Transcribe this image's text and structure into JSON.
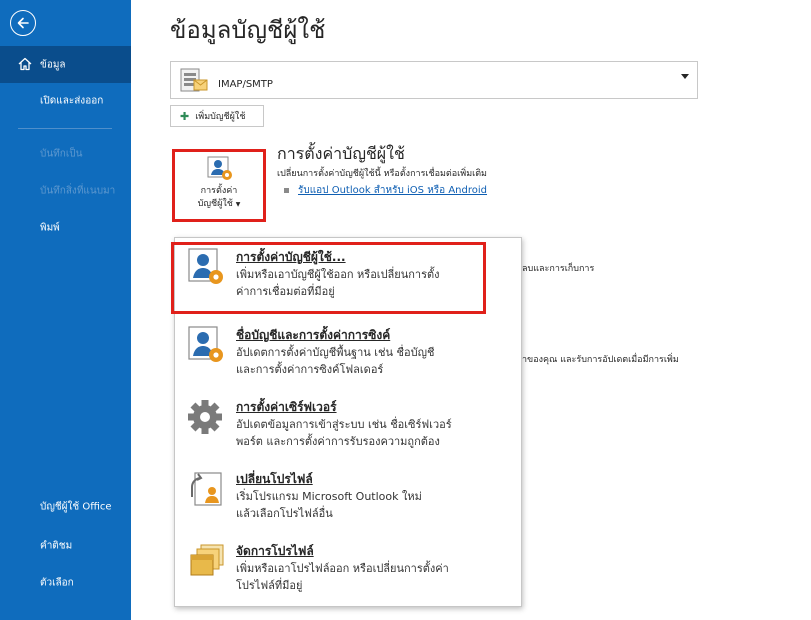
{
  "page": {
    "title": "ข้อมูลบัญชีผู้ใช้"
  },
  "sidebar": {
    "back_icon": "arrow-left-circle-icon",
    "items": [
      {
        "label": "ข้อมูล",
        "icon": "home-icon",
        "selected": true
      },
      {
        "label": "เปิดและส่งออก"
      },
      {
        "label": "บันทึกเป็น",
        "disabled": true
      },
      {
        "label": "บันทึกสิ่งที่แนบมา",
        "disabled": true
      },
      {
        "label": "พิมพ์"
      },
      {
        "label": "บัญชีผู้ใช้ Office"
      },
      {
        "label": "คำติชม"
      },
      {
        "label": "ตัวเลือก"
      }
    ]
  },
  "account": {
    "selected_value": "IMAP/SMTP",
    "add_account_label": "เพิ่มบัญชีผู้ใช้"
  },
  "account_settings": {
    "button_line1": "การตั้งค่า",
    "button_line2": "บัญชีผู้ใช้",
    "title": "การตั้งค่าบัญชีผู้ใช้",
    "description": "เปลี่ยนการตั้งค่าบัญชีผู้ใช้นี้ หรือตั้งการเชื่อมต่อเพิ่มเติม",
    "link": "รับแอป Outlook สำหรับ iOS หรือ Android"
  },
  "background_peek": {
    "line1": "ลบและการเก็บการ",
    "line2": "ำของคุณ และรับการอัปเดตเมื่อมีการเพิ่ม"
  },
  "menu": {
    "items": [
      {
        "title": "การตั้งค่าบัญชีผู้ใช้...",
        "desc1": "เพิ่มหรือเอาบัญชีผู้ใช้ออก หรือเปลี่ยนการตั้ง",
        "desc2": "ค่าการเชื่อมต่อที่มีอยู่",
        "icon": "account-settings-icon"
      },
      {
        "title": "ชื่อบัญชีและการตั้งค่าการซิงค์",
        "desc1": "อัปเดตการตั้งค่าบัญชีพื้นฐาน เช่น ชื่อบัญชี",
        "desc2": "และการตั้งค่าการซิงค์โฟลเดอร์",
        "icon": "account-sync-icon"
      },
      {
        "title": "การตั้งค่าเซิร์ฟเวอร์",
        "desc1": "อัปเดตข้อมูลการเข้าสู่ระบบ เช่น ชื่อเซิร์ฟเวอร์",
        "desc2": "พอร์ต และการตั้งค่าการรับรองความถูกต้อง",
        "icon": "gear-icon"
      },
      {
        "title": "เปลี่ยนโปรไฟล์",
        "desc1": "เริ่มโปรแกรม Microsoft Outlook ใหม่",
        "desc2": "แล้วเลือกโปรไฟล์อื่น",
        "icon": "change-profile-icon"
      },
      {
        "title": "จัดการโปรไฟล์",
        "desc1": "เพิ่มหรือเอาโปรไฟล์ออก หรือเปลี่ยนการตั้งค่า",
        "desc2": "โปรไฟล์ที่มีอยู่",
        "icon": "manage-profiles-icon"
      }
    ]
  },
  "colors": {
    "sidebar_bg": "#0f6cbd",
    "sidebar_selected": "#0a4d8c",
    "highlight_red": "#e0201a",
    "link_blue": "#0f5fb3",
    "icon_blue": "#2b6cb0",
    "icon_orange": "#e8961e"
  }
}
